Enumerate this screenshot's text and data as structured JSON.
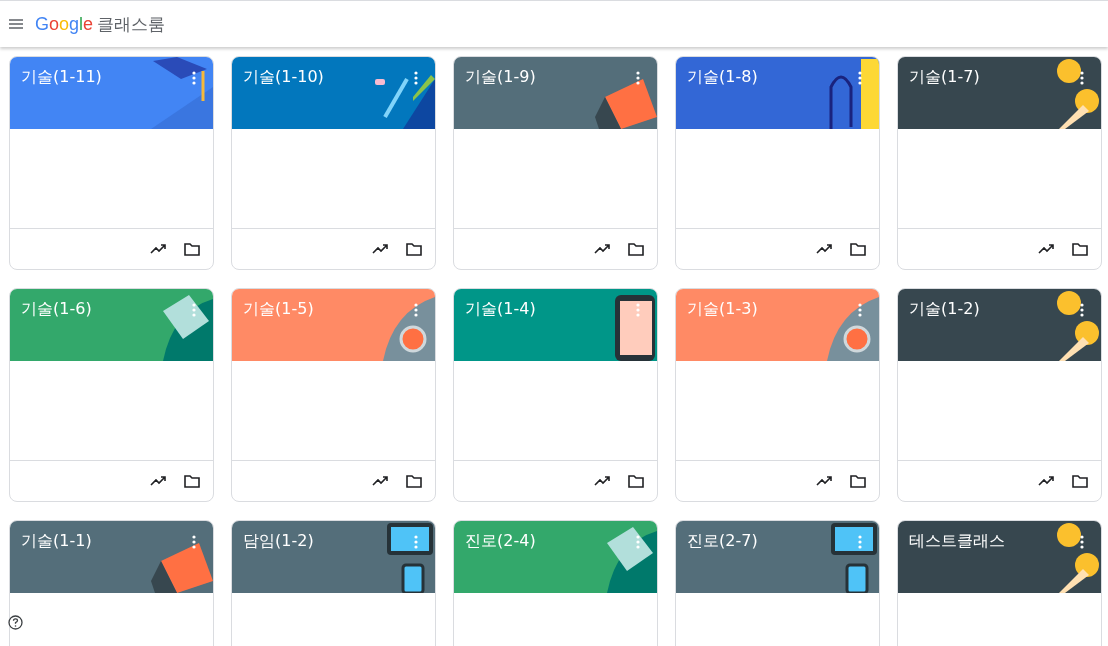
{
  "header": {
    "logo": "Google",
    "product": "클래스룸"
  },
  "classes": [
    {
      "name": "기술(1-11)",
      "color": "#4285f4",
      "kind": "cap"
    },
    {
      "name": "기술(1-10)",
      "color": "#0277bd",
      "kind": "pencil"
    },
    {
      "name": "기술(1-9)",
      "color": "#546e7a",
      "kind": "book"
    },
    {
      "name": "기술(1-8)",
      "color": "#3367d6",
      "kind": "headphones"
    },
    {
      "name": "기술(1-7)",
      "color": "#37474f",
      "kind": "coins"
    },
    {
      "name": "기술(1-6)",
      "color": "#33a86b",
      "kind": "notebook"
    },
    {
      "name": "기술(1-5)",
      "color": "#ff8a65",
      "kind": "lab"
    },
    {
      "name": "기술(1-4)",
      "color": "#009688",
      "kind": "phone"
    },
    {
      "name": "기술(1-3)",
      "color": "#ff8a65",
      "kind": "lab"
    },
    {
      "name": "기술(1-2)",
      "color": "#37474f",
      "kind": "coins"
    },
    {
      "name": "기술(1-1)",
      "color": "#546e7a",
      "kind": "book"
    },
    {
      "name": "담임(1-2)",
      "color": "#546e7a",
      "kind": "tablet"
    },
    {
      "name": "진로(2-4)",
      "color": "#33a86b",
      "kind": "notebook"
    },
    {
      "name": "진로(2-7)",
      "color": "#546e7a",
      "kind": "tablet"
    },
    {
      "name": "테스트클래스",
      "color": "#37474f",
      "kind": "coins"
    }
  ]
}
